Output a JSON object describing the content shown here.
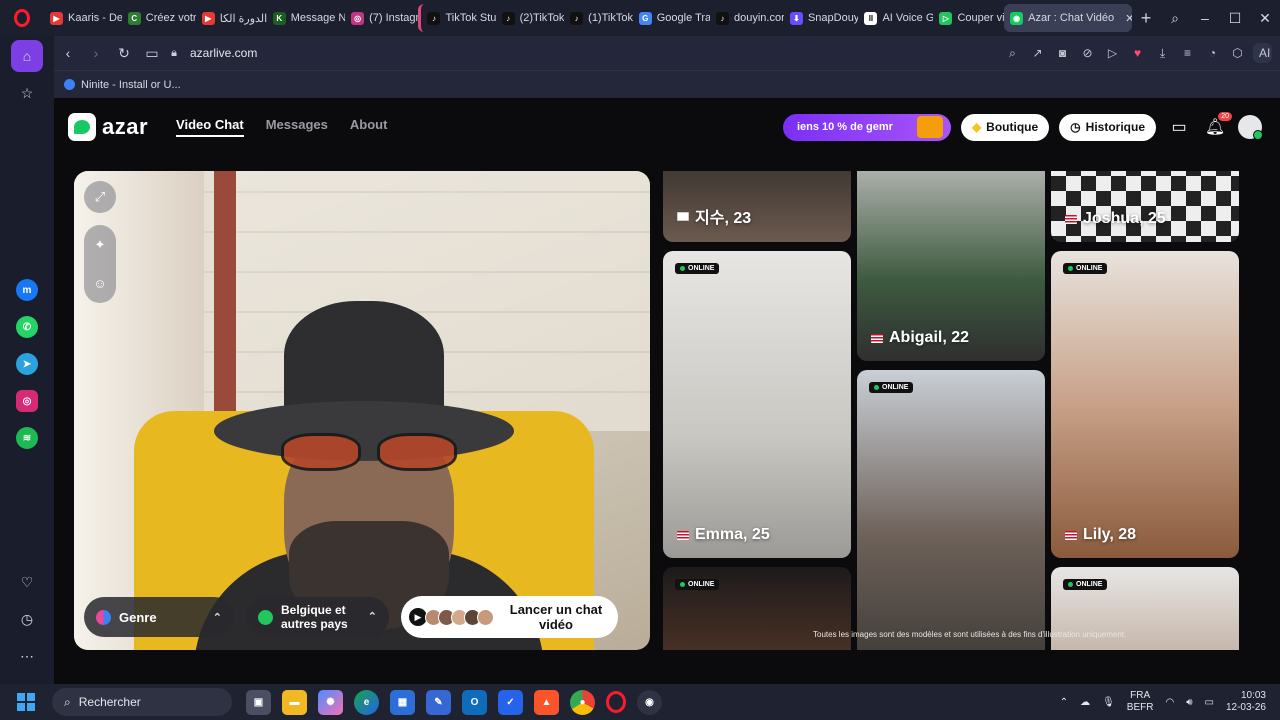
{
  "browser": {
    "tabs": [
      {
        "label": "Kaaris - De",
        "color": "#e53935",
        "glyph": "▶"
      },
      {
        "label": "Créez votr",
        "color": "#2e7d32",
        "glyph": "C"
      },
      {
        "label": "الدورة الكا",
        "color": "#e53935",
        "glyph": "▶"
      },
      {
        "label": "Message N",
        "color": "#1b5e20",
        "glyph": "K"
      },
      {
        "label": "(7) Instagr",
        "color": "#c13584",
        "glyph": "◎"
      },
      {
        "label": "TikTok Stu",
        "color": "#111111",
        "glyph": "♪"
      },
      {
        "label": "(2)TikTok",
        "color": "#111111",
        "glyph": "♪"
      },
      {
        "label": "(1)TikTok",
        "color": "#111111",
        "glyph": "♪"
      },
      {
        "label": "Google Tra",
        "color": "#4285f4",
        "glyph": "G"
      },
      {
        "label": "douyin.cor",
        "color": "#111111",
        "glyph": "♪"
      },
      {
        "label": "SnapDouy",
        "color": "#6a4cff",
        "glyph": "⬇"
      },
      {
        "label": "AI Voice G",
        "color": "#ffffff",
        "glyph": "II"
      },
      {
        "label": "Couper vi",
        "color": "#22c55e",
        "glyph": "▷"
      },
      {
        "label": "Azar : Chat Vidéo",
        "color": "#17c964",
        "glyph": "◉"
      }
    ],
    "url": "azarlive.com",
    "ai_label": "AI",
    "bookmark": "Ninite - Install or U..."
  },
  "site": {
    "logo": "azar",
    "nav": {
      "video_chat": "Video Chat",
      "messages": "Messages",
      "about": "About"
    },
    "promo": "iens 10 % de gemr",
    "boutique": "Boutique",
    "historique": "Historique",
    "notif_count": "20"
  },
  "camera": {
    "genre": "Genre",
    "country": "Belgique et autres pays",
    "launch": "Lancer un chat vidéo"
  },
  "profiles": {
    "online_label": "ONLINE",
    "cards": [
      {
        "name": "지수, 23",
        "flag": "kr",
        "online": false,
        "bg": "linear-gradient(180deg,#3b3431,#6b5a4e)"
      },
      {
        "name": "Emma, 25",
        "flag": "us",
        "online": true,
        "bg": "linear-gradient(180deg,#e7e6e3,#c9c7c2 60%,#9c9a96)"
      },
      {
        "name": "",
        "flag": "",
        "online": true,
        "bg": "linear-gradient(180deg,#1d1a1a,#5a3a2a)"
      },
      {
        "name": "Abigail, 22",
        "flag": "us",
        "online": false,
        "bg": "linear-gradient(180deg,#b6b7b3,#3d5a3f 60%,#2f2f2f)"
      },
      {
        "name": "",
        "flag": "",
        "online": true,
        "bg": "linear-gradient(180deg,#c9cfd6,#6e625a 55%,#3e3a36)"
      },
      {
        "name": "Joshua, 25",
        "flag": "us",
        "online": false,
        "bg": "repeating-conic-gradient(#222 0 25%, #eee 0 50%) 0 0/30px 30px"
      },
      {
        "name": "Lily, 28",
        "flag": "us",
        "online": true,
        "bg": "linear-gradient(180deg,#e8e3dd,#c8a188 50%,#8a5a3c)"
      },
      {
        "name": "",
        "flag": "",
        "online": true,
        "bg": "linear-gradient(180deg,#e7e6e4,#b8a292)"
      }
    ],
    "disclaimer": "Toutes les images sont des modèles et sont utilisées à des fins d'illustration uniquement."
  },
  "taskbar": {
    "search": "Rechercher",
    "lang_top": "FRA",
    "lang_bottom": "BEFR",
    "time": "10:03",
    "date": "12-03-26"
  }
}
